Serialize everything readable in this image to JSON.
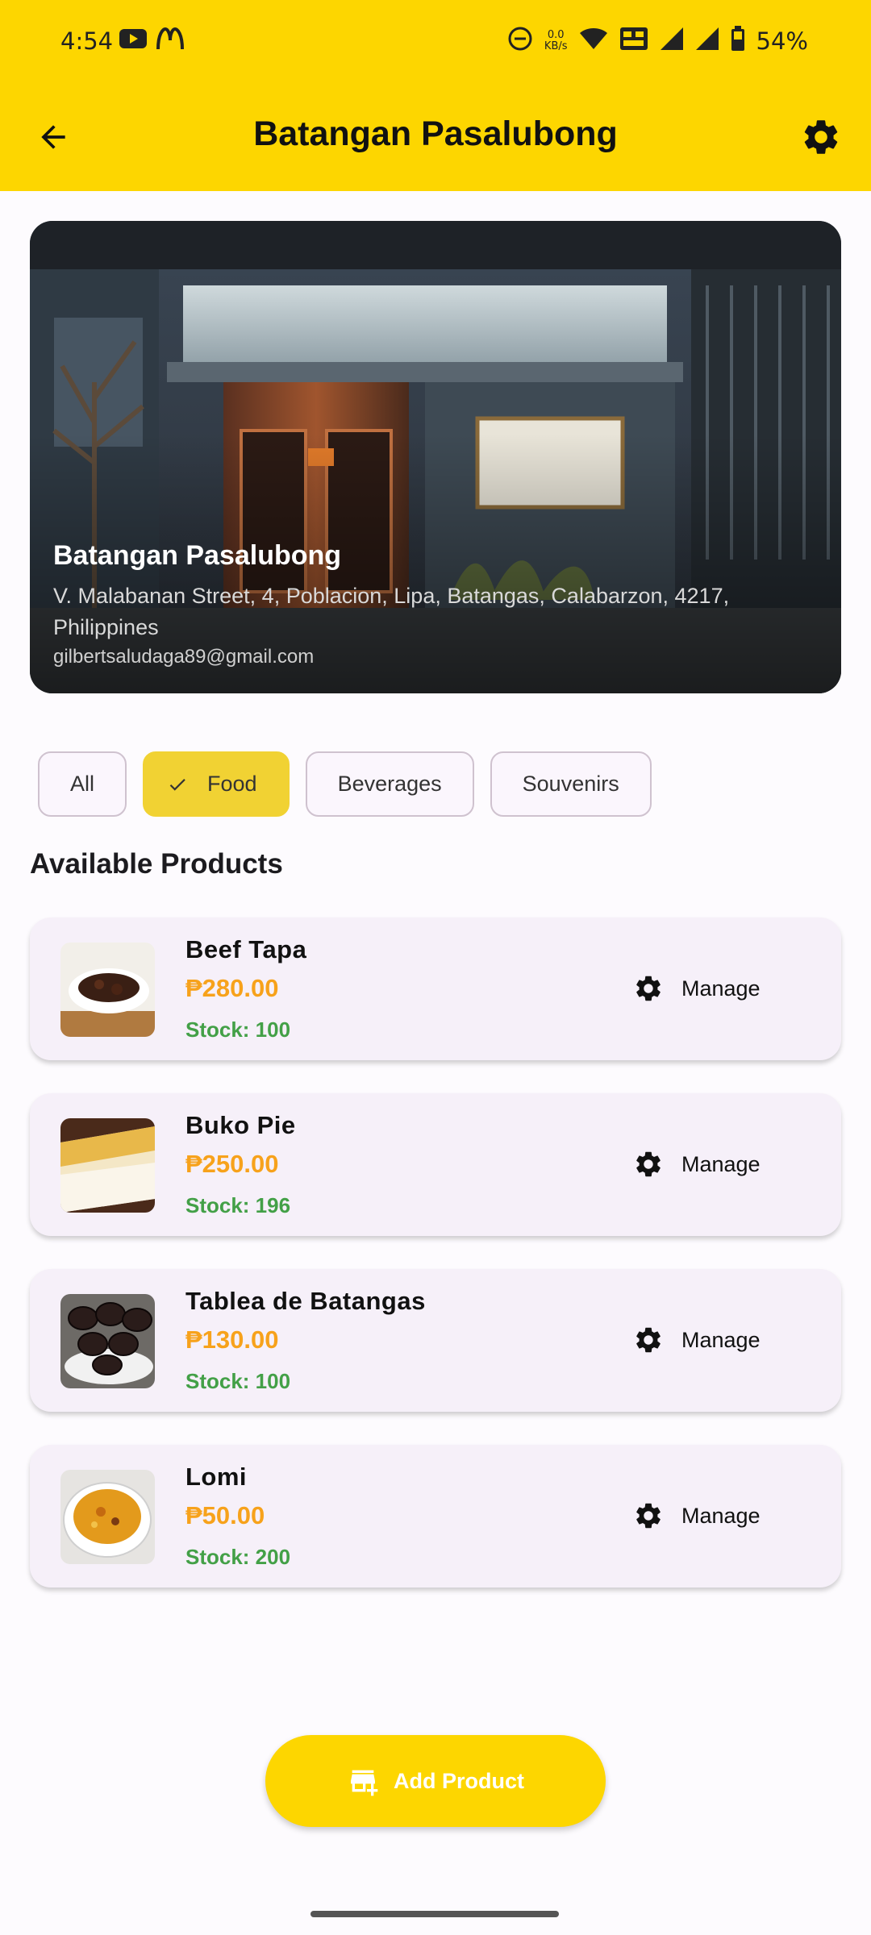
{
  "status_bar": {
    "time": "4:54",
    "speed_value": "0.0",
    "speed_unit": "KB/s",
    "battery": "54%",
    "icons": [
      "youtube-icon",
      "mcdonalds-icon",
      "dnd-icon",
      "wifi-icon",
      "volte-icon",
      "signal-icon",
      "signal-icon",
      "battery-icon"
    ]
  },
  "app_bar": {
    "title": "Batangan Pasalubong",
    "back_icon": "arrow-back-icon",
    "settings_icon": "gear-icon"
  },
  "store": {
    "name": "Batangan Pasalubong",
    "address": "V. Malabanan Street, 4, Poblacion, Lipa, Batangas, Calabarzon, 4217, Philippines",
    "email": "gilbertsaludaga89@gmail.com"
  },
  "filters": {
    "chips": [
      {
        "label": "All",
        "selected": false
      },
      {
        "label": "Food",
        "selected": true
      },
      {
        "label": "Beverages",
        "selected": false
      },
      {
        "label": "Souvenirs",
        "selected": false
      }
    ]
  },
  "products_section": {
    "title": "Available Products",
    "manage_label": "Manage",
    "items": [
      {
        "name": "Beef Tapa",
        "price": "₱280.00",
        "stock": "Stock: 100"
      },
      {
        "name": "Buko Pie",
        "price": "₱250.00",
        "stock": "Stock: 196"
      },
      {
        "name": "Tablea de Batangas",
        "price": "₱130.00",
        "stock": "Stock: 100"
      },
      {
        "name": "Lomi",
        "price": "₱50.00",
        "stock": "Stock: 200"
      }
    ]
  },
  "fab": {
    "label": "Add Product",
    "icon": "add-store-icon"
  },
  "colors": {
    "primary_yellow": "#FDD600",
    "chip_selected": "#F1D233",
    "price_orange": "#F7A21B",
    "stock_green": "#43A047",
    "card_bg": "#F6F0F9"
  }
}
